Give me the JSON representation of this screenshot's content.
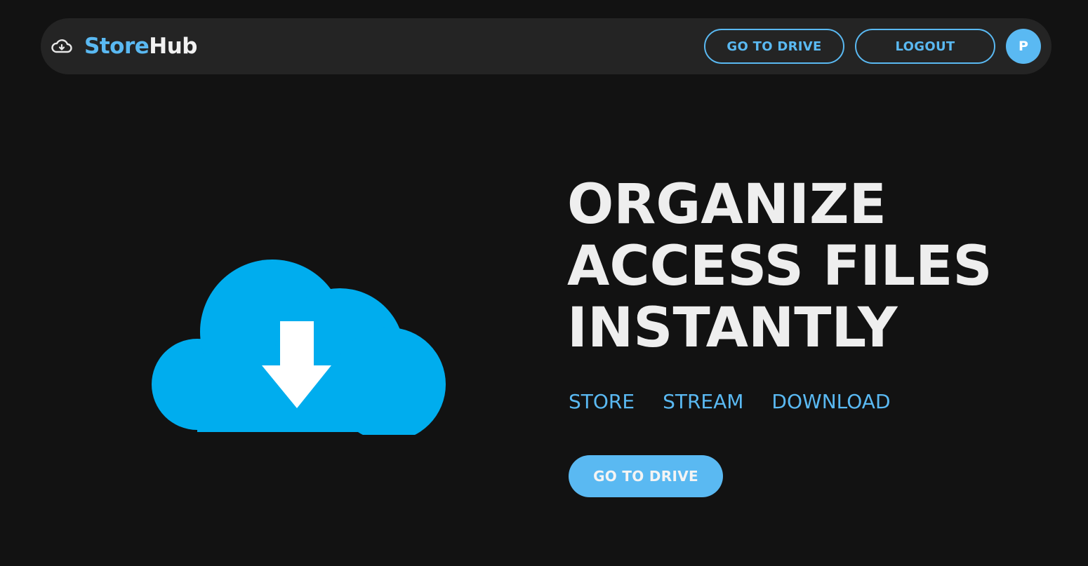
{
  "header": {
    "brand": {
      "icon": "cloud-download-icon",
      "store": "Store",
      "hub": "Hub"
    },
    "go_to_drive_label": "GO TO DRIVE",
    "logout_label": "LOGOUT",
    "avatar_initial": "P"
  },
  "hero": {
    "illustration_icon": "cloud-download-icon",
    "headline": [
      "ORGANIZE",
      "ACCESS FILES",
      "INSTANTLY"
    ],
    "features": [
      "STORE",
      "STREAM",
      "DOWNLOAD"
    ],
    "cta_label": "GO TO DRIVE"
  },
  "colors": {
    "background": "#121212",
    "navbar": "#242424",
    "accent": "#5ab9f2",
    "illustration": "#00adee",
    "text": "#eeeeee"
  }
}
